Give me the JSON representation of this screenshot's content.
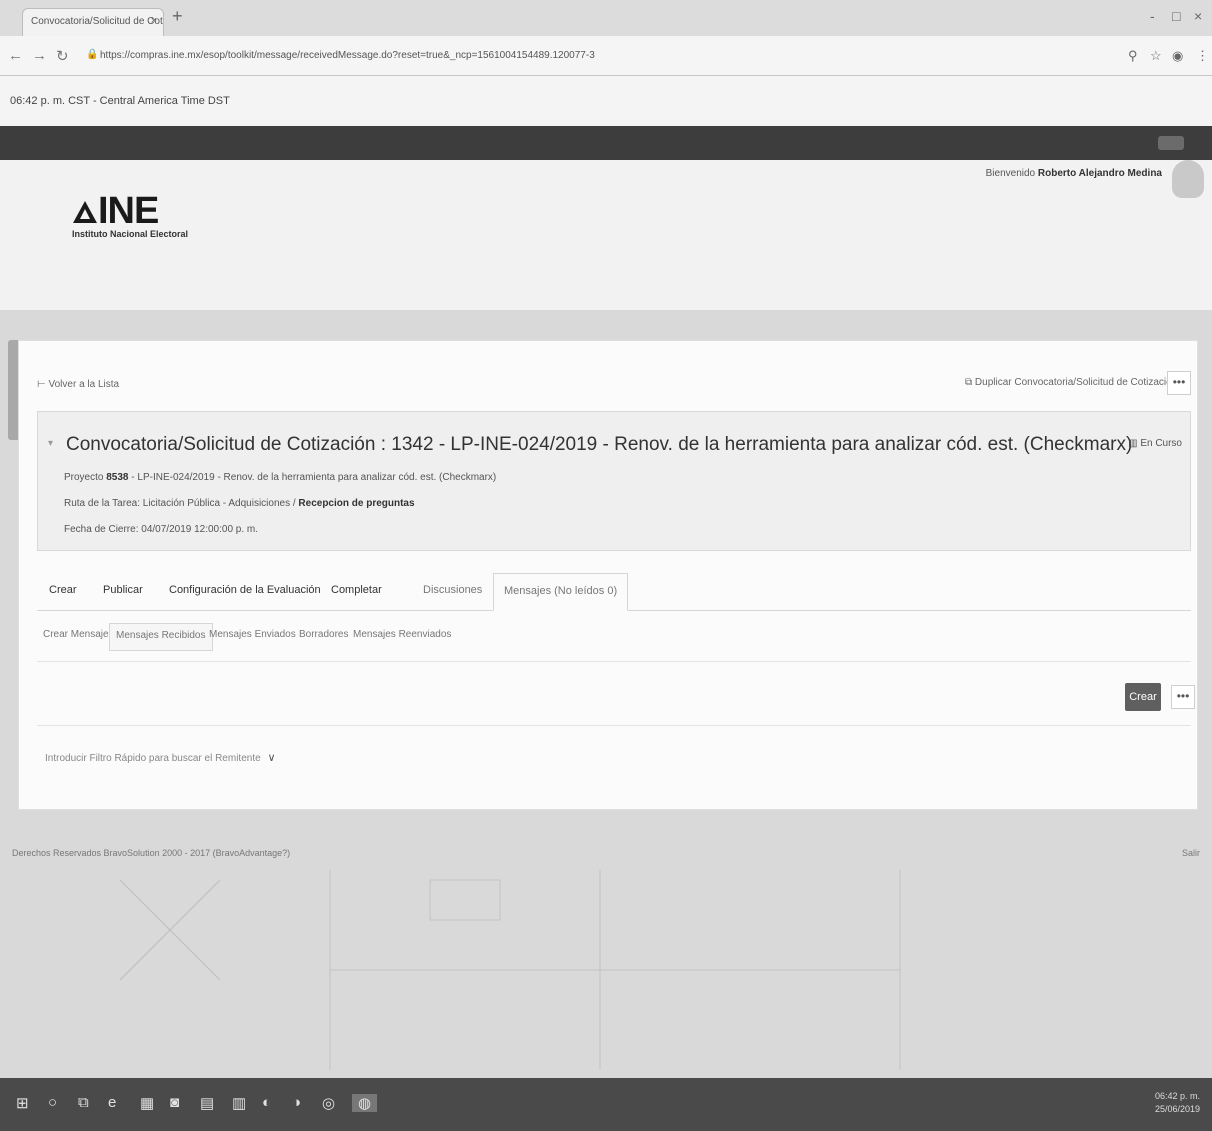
{
  "browser": {
    "tab_title": "Convocatoria/Solicitud de Cotiza",
    "tab_close": "×",
    "new_tab": "+",
    "url": "https://compras.ine.mx/esop/toolkit/message/receivedMessage.do?reset=true&_ncp=1561004154489.120077-3",
    "minimize": "-",
    "maximize": "□",
    "close": "×"
  },
  "timezone_bar": {
    "text": "06:42 p. m. CST - Central America Time DST"
  },
  "header": {
    "welcome_prefix": "Bienvenido",
    "user_name": "Roberto Alejandro Medina",
    "logo_text": "INE",
    "logo_subtitle": "Instituto Nacional Electoral"
  },
  "toolbar": {
    "back_label": "Volver a la Lista",
    "duplicate_label": "Duplicar Convocatoria/Solicitud de Cotización",
    "more_label": "•••"
  },
  "info": {
    "title": "Convocatoria/Solicitud de Cotización : 1342 - LP-INE-024/2019 - Renov. de la herramienta para analizar cód. est. (Checkmarx)",
    "status": "En Curso",
    "project_label": "Proyecto",
    "project_id": "8538",
    "project_text": "- LP-INE-024/2019 - Renov. de la herramienta para analizar cód. est. (Checkmarx)",
    "route_label": "Ruta de la Tarea:",
    "route_text": "Licitación Pública - Adquisiciones /",
    "route_current": "Recepcion de preguntas",
    "close_date_label": "Fecha de Cierre:",
    "close_date": "04/07/2019 12:00:00 p. m."
  },
  "tabs": [
    {
      "label": "Crear"
    },
    {
      "label": "Publicar"
    },
    {
      "label": "Configuración de la Evaluación"
    },
    {
      "label": "Completar"
    },
    {
      "label": "Discusiones"
    },
    {
      "label": "Mensajes (No leídos 0)"
    }
  ],
  "subtabs": [
    {
      "label": "Crear Mensaje"
    },
    {
      "label": "Mensajes Recibidos"
    },
    {
      "label": "Mensajes Enviados"
    },
    {
      "label": "Borradores"
    },
    {
      "label": "Mensajes Reenviados"
    }
  ],
  "actions": {
    "create_label": "Crear",
    "more_label": "•••"
  },
  "filter": {
    "placeholder": "Introducir Filtro Rápido para buscar el Remitente"
  },
  "footer": {
    "left": "Derechos Reservados BravoSolution 2000 - 2017 (BravoAdvantage?)",
    "right": "Salir"
  },
  "tray": {
    "time": "06:42 p. m.",
    "date": "25/06/2019"
  }
}
